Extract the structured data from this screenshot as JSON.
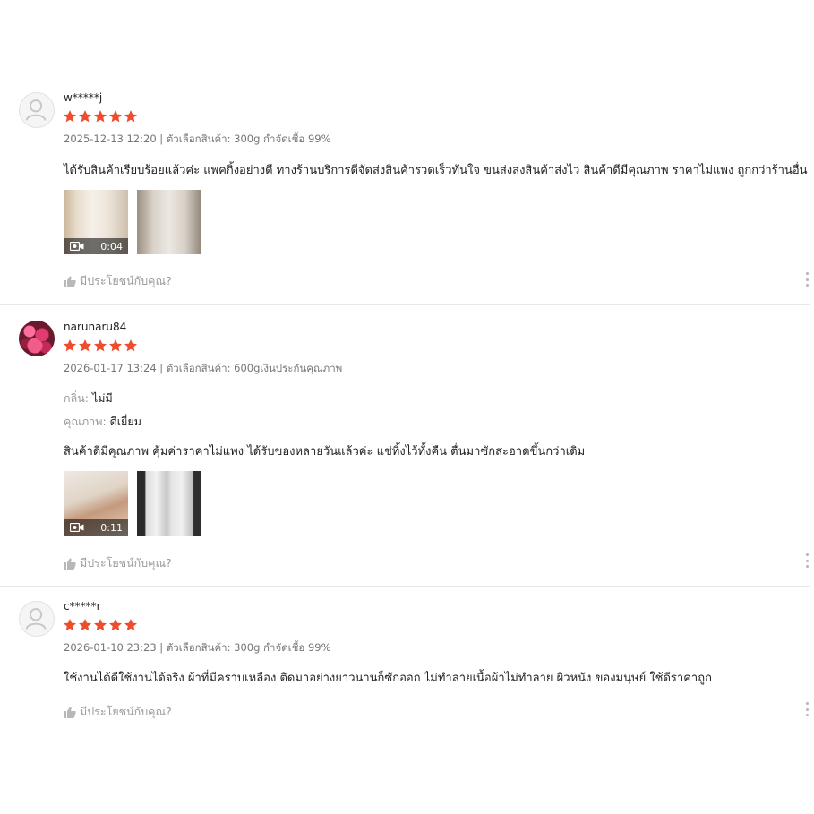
{
  "helpful_label": "มีประโยชน์กับคุณ?",
  "star_color": "#ee4d2d",
  "reviews": [
    {
      "username": "w*****j",
      "avatar": "default-user-icon",
      "rating": 5,
      "meta": "2025-12-13 12:20 | ตัวเลือกสินค้า: 300g กำจัดเชื้อ 99%",
      "comment": "ได้รับสินค้าเรียบร้อยแล้วค่ะ แพคกิ้งอย่างดี ทางร้านบริการดีจัดส่งสินค้ารวดเร็วทันใจ ขนส่งส่งสินค้าส่งไว สินค้าดีมีคุณภาพ ราคาไม่แพง ถูกกว่าร้านอื่น",
      "media": [
        {
          "type": "video",
          "duration": "0:04"
        },
        {
          "type": "image"
        }
      ]
    },
    {
      "username": "narunaru84",
      "avatar": "user-photo",
      "rating": 5,
      "meta": "2026-01-17 13:24 | ตัวเลือกสินค้า: 600gเงินประกันคุณภาพ",
      "attributes": [
        {
          "label": "กลิ่น:",
          "value": "ไม่มี"
        },
        {
          "label": "คุณภาพ:",
          "value": "ดีเยี่ยม"
        }
      ],
      "comment": "สินค้าดีมีคุณภาพ คุ้มค่าราคาไม่แพง ได้รับของหลายวันแล้วค่ะ แช่ทิ้งไว้ทั้งคืน ตื่นมาซักสะอาดขึ้นกว่าเดิม",
      "media": [
        {
          "type": "video",
          "duration": "0:11"
        },
        {
          "type": "image"
        }
      ]
    },
    {
      "username": "c*****r",
      "avatar": "default-user-icon",
      "rating": 5,
      "meta": "2026-01-10 23:23 | ตัวเลือกสินค้า: 300g กำจัดเชื้อ 99%",
      "comment": "ใช้งานได้ดีใช้งานได้จริง ผ้าที่มีคราบเหลือง ติดมาอย่างยาวนานก็ซักออก ไม่ทำลายเนื้อผ้าไม่ทำลาย ผิวหนัง ของมนุษย์ ใช้ดีราคาถูก"
    }
  ]
}
